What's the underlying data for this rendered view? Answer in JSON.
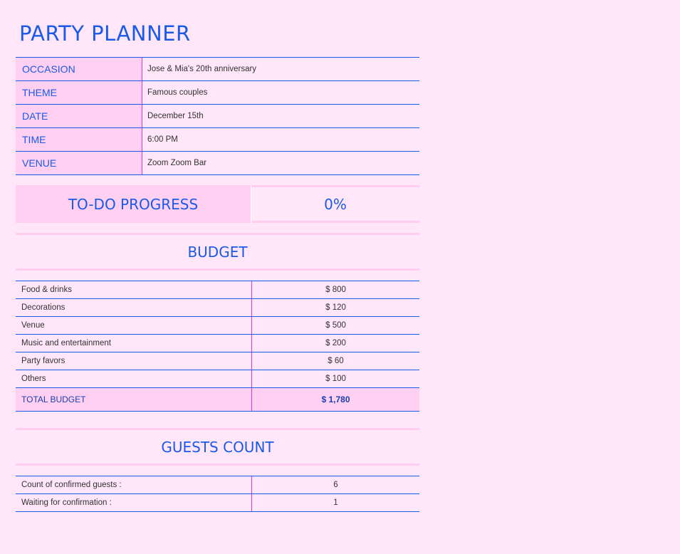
{
  "title": "PARTY PLANNER",
  "details": [
    {
      "label": "OCCASION",
      "value": "Jose & Mia's 20th anniversary"
    },
    {
      "label": "THEME",
      "value": "Famous couples"
    },
    {
      "label": "DATE",
      "value": "December 15th"
    },
    {
      "label": "TIME",
      "value": "6:00 PM"
    },
    {
      "label": "VENUE",
      "value": "Zoom Zoom Bar"
    }
  ],
  "progress": {
    "label": "TO-DO PROGRESS",
    "value": "0%"
  },
  "budget": {
    "heading": "BUDGET",
    "items": [
      {
        "label": "Food & drinks",
        "amount": "$ 800"
      },
      {
        "label": "Decorations",
        "amount": "$ 120"
      },
      {
        "label": "Venue",
        "amount": "$ 500"
      },
      {
        "label": "Music and entertainment",
        "amount": "$ 200"
      },
      {
        "label": "Party favors",
        "amount": "$ 60"
      },
      {
        "label": "Others",
        "amount": "$ 100"
      }
    ],
    "total_label": "TOTAL BUDGET",
    "total_amount": "$ 1,780"
  },
  "guests": {
    "heading": "GUESTS COUNT",
    "items": [
      {
        "label": "Count of confirmed guests :",
        "value": "6"
      },
      {
        "label": "Waiting for confirmation :",
        "value": "1"
      }
    ]
  },
  "colors": {
    "background": "#ffe6f8",
    "accent_blue": "#1a5ae8",
    "label_fill": "#ffd0f2",
    "divider_magenta": "#e23ac8"
  }
}
